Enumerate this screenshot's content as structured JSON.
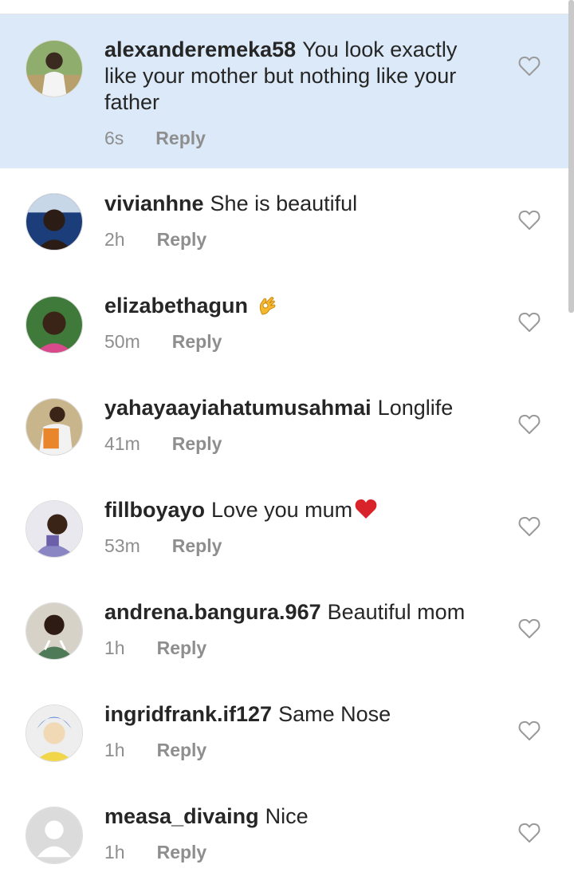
{
  "comments": [
    {
      "username": "alexanderemeka58",
      "text": "You look exactly like your mother but nothing like your father",
      "emoji": "",
      "time": "6s",
      "reply": "Reply",
      "highlighted": true,
      "avatar_color": "#7a9a60"
    },
    {
      "username": "vivianhne",
      "text": "She is beautiful",
      "emoji": "",
      "time": "2h",
      "reply": "Reply",
      "highlighted": false,
      "avatar_color": "#1b3d7a"
    },
    {
      "username": "elizabethagun",
      "text": "",
      "emoji": "ok-hand",
      "time": "50m",
      "reply": "Reply",
      "highlighted": false,
      "avatar_color": "#3f7a3a"
    },
    {
      "username": "yahayaayiahatumusahmai",
      "text": "Longlife",
      "emoji": "",
      "time": "41m",
      "reply": "Reply",
      "highlighted": false,
      "avatar_color": "#d98a3a"
    },
    {
      "username": "fillboyayo",
      "text": "Love you mum",
      "emoji": "red-heart",
      "time": "53m",
      "reply": "Reply",
      "highlighted": false,
      "avatar_color": "#8a86c4"
    },
    {
      "username": "andrena.bangura.967",
      "text": "Beautiful mom",
      "emoji": "",
      "time": "1h",
      "reply": "Reply",
      "highlighted": false,
      "avatar_color": "#4f7a57"
    },
    {
      "username": "ingridfrank.if127",
      "text": "Same Nose",
      "emoji": "",
      "time": "1h",
      "reply": "Reply",
      "highlighted": false,
      "avatar_color": "#3c6fd1"
    },
    {
      "username": "measa_divaing",
      "text": "Nice",
      "emoji": "",
      "time": "1h",
      "reply": "Reply",
      "highlighted": false,
      "avatar_color": "#dbdbdb"
    }
  ],
  "colors": {
    "highlight_bg": "#dbe9f8",
    "username": "#262626",
    "meta": "#8e8e8e"
  }
}
